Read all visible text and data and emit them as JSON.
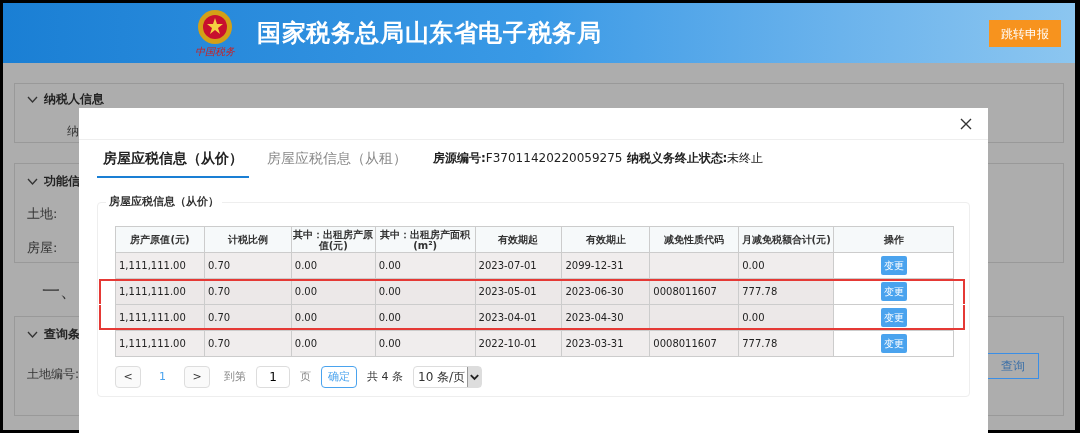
{
  "header": {
    "title": "国家税务总局山东省电子税务局",
    "logo_text": "中国税务",
    "button": "跳转申报"
  },
  "background": {
    "section_1": {
      "title": "纳税人信息",
      "field_label": "纳"
    },
    "section_2": {
      "title": "功能信",
      "labels": [
        "土地:",
        "房屋:"
      ]
    },
    "heading": "一、",
    "section_3": {
      "title": "查询条",
      "field_label": "土地编号:",
      "button": "查询"
    }
  },
  "modal": {
    "tabs": [
      {
        "label": "房屋应税信息（从价）",
        "selected": true
      },
      {
        "label": "房屋应税信息（从租）",
        "selected": false
      }
    ],
    "info": [
      {
        "label": "房源编号:",
        "value": "F37011420220059275"
      },
      {
        "label": "纳税义务终止状态:",
        "value": "未终止"
      }
    ],
    "fieldset_title": "房屋应税信息（从价）",
    "table": {
      "columns": [
        "房产原值(元)",
        "计税比例",
        "其中：出租房产原值(元)",
        "其中：出租房产面积(m²)",
        "有效期起",
        "有效期止",
        "减免性质代码",
        "月减免税额合计(元)",
        "操作"
      ],
      "rows": [
        {
          "cells": [
            "1,111,111.00",
            "0.70",
            "0.00",
            "0.00",
            "2023-07-01",
            "2099-12-31",
            "",
            "0.00"
          ],
          "action": "变更",
          "highlighted": false
        },
        {
          "cells": [
            "1,111,111.00",
            "0.70",
            "0.00",
            "0.00",
            "2023-05-01",
            "2023-06-30",
            "0008011607",
            "777.78"
          ],
          "action": "变更",
          "highlighted": true
        },
        {
          "cells": [
            "1,111,111.00",
            "0.70",
            "0.00",
            "0.00",
            "2023-04-01",
            "2023-04-30",
            "",
            "0.00"
          ],
          "action": "变更",
          "highlighted": true
        },
        {
          "cells": [
            "1,111,111.00",
            "0.70",
            "0.00",
            "0.00",
            "2022-10-01",
            "2023-03-31",
            "0008011607",
            "777.78"
          ],
          "action": "变更",
          "highlighted": false
        }
      ]
    },
    "pagination": {
      "prev": "<",
      "current_page": "1",
      "next": ">",
      "goto_label": "到第",
      "page_input": "1",
      "page_unit": "页",
      "confirm": "确定",
      "total": "共 4 条",
      "page_size": "10 条/页"
    }
  }
}
